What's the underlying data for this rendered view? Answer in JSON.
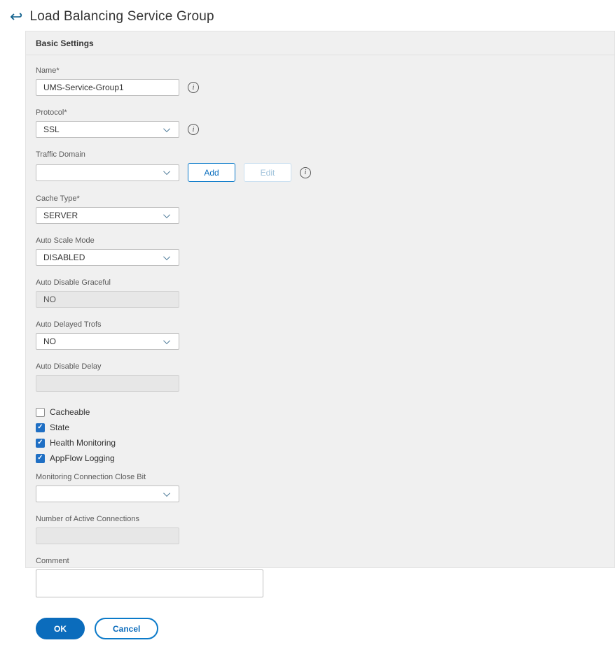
{
  "header": {
    "title": "Load Balancing Service Group",
    "back_icon": "↩"
  },
  "panel": {
    "title": "Basic Settings",
    "fields": {
      "name": {
        "label": "Name*",
        "value": "UMS-Service-Group1"
      },
      "protocol": {
        "label": "Protocol*",
        "value": "SSL"
      },
      "traffic_domain": {
        "label": "Traffic Domain",
        "value": "",
        "add_label": "Add",
        "edit_label": "Edit"
      },
      "cache_type": {
        "label": "Cache Type*",
        "value": "SERVER"
      },
      "auto_scale_mode": {
        "label": "Auto Scale Mode",
        "value": "DISABLED"
      },
      "auto_disable_graceful": {
        "label": "Auto Disable Graceful",
        "value": "NO"
      },
      "auto_delayed_trofs": {
        "label": "Auto Delayed Trofs",
        "value": "NO"
      },
      "auto_disable_delay": {
        "label": "Auto Disable Delay",
        "value": ""
      },
      "monitoring_connection_close_bit": {
        "label": "Monitoring Connection Close Bit",
        "value": ""
      },
      "number_of_active_connections": {
        "label": "Number of Active Connections",
        "value": ""
      },
      "comment": {
        "label": "Comment",
        "value": ""
      }
    },
    "checkboxes": [
      {
        "label": "Cacheable",
        "checked": false
      },
      {
        "label": "State",
        "checked": true
      },
      {
        "label": "Health Monitoring",
        "checked": true
      },
      {
        "label": "AppFlow Logging",
        "checked": true
      }
    ],
    "buttons": {
      "ok": "OK",
      "cancel": "Cancel"
    }
  },
  "colors": {
    "accent": "#0b7ac9",
    "panel_bg": "#f0f0f0",
    "ok_blue": "#0b6cbc"
  }
}
